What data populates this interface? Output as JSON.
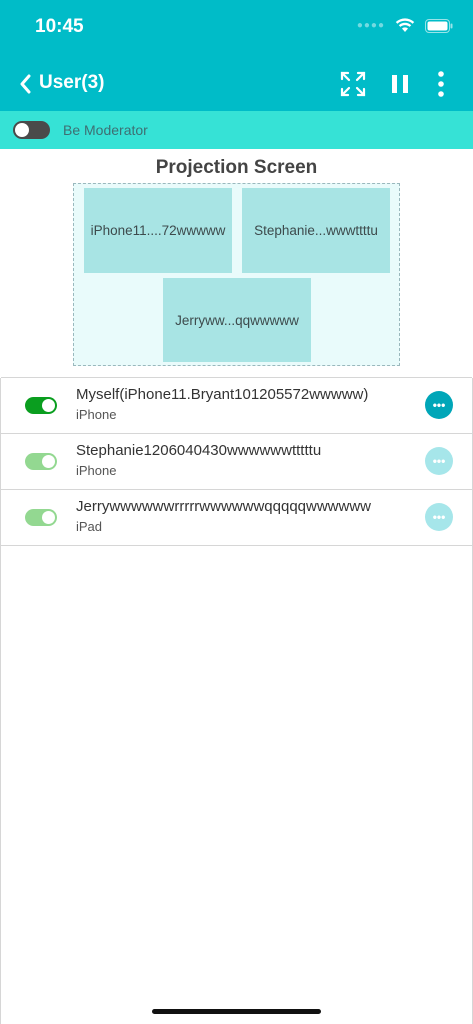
{
  "status": {
    "time": "10:45"
  },
  "header": {
    "title": "User(3)"
  },
  "moderator": {
    "label": "Be Moderator",
    "enabled": false
  },
  "projection": {
    "title": "Projection Screen",
    "tiles": [
      "iPhone11....72wwwww",
      "Stephanie...wwwttttu",
      "Jerryww...qqwwwww"
    ]
  },
  "users": [
    {
      "name": "Myself(iPhone11.Bryant101205572wwwww)",
      "device": "iPhone",
      "enabled": true,
      "active": true
    },
    {
      "name": "Stephanie1206040430wwwwwwtttttu",
      "device": "iPhone",
      "enabled": true,
      "active": false
    },
    {
      "name": "Jerrywwwwwwrrrrrwwwwwwqqqqqwwwwww",
      "device": "iPad",
      "enabled": true,
      "active": false
    }
  ],
  "colors": {
    "header": "#00bcc8",
    "moderator_bar": "#36e2d6",
    "toggle_on_active": "#0a9e1f",
    "toggle_on_inactive": "#93d891",
    "more_active": "#00a6b8",
    "more_inactive": "#a6e6ea"
  },
  "icons": [
    "back-chevron-icon",
    "fullscreen-icon",
    "pause-icon",
    "more-vertical-icon",
    "wifi-icon",
    "battery-icon",
    "more-horizontal-icon"
  ]
}
